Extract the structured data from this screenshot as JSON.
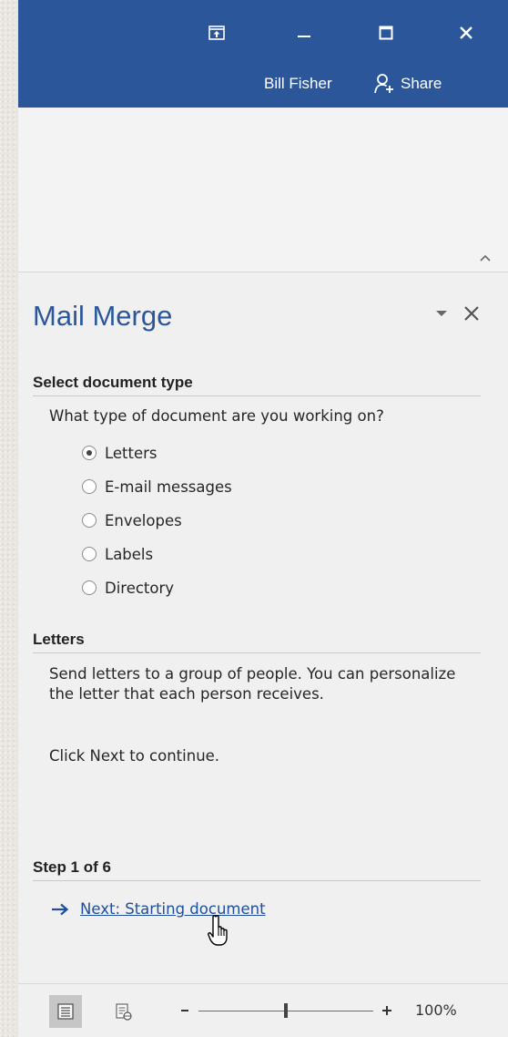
{
  "titlebar": {
    "user_name": "Bill Fisher",
    "share_label": "Share",
    "accent": "#2b579a"
  },
  "pane": {
    "title": "Mail Merge",
    "select_heading": "Select document type",
    "question": "What type of document are you working on?",
    "options": [
      {
        "label": "Letters",
        "checked": true
      },
      {
        "label": "E-mail messages",
        "checked": false
      },
      {
        "label": "Envelopes",
        "checked": false
      },
      {
        "label": "Labels",
        "checked": false
      },
      {
        "label": "Directory",
        "checked": false
      }
    ],
    "description_heading": "Letters",
    "description": "Send letters to a group of people. You can personalize the letter that each person receives.",
    "instruction": "Click Next to continue.",
    "step_heading": "Step 1 of 6",
    "next_link": "Next: Starting document"
  },
  "statusbar": {
    "zoom_level": "100%",
    "zoom_percent": 100
  },
  "icons": {
    "ribbon_display": "ribbon-display-options-icon",
    "minimize": "minimize-icon",
    "maximize": "maximize-icon",
    "close": "close-icon",
    "share": "person-add-icon",
    "collapse": "chevron-up-icon",
    "pane_menu": "triangle-down-icon",
    "pane_close": "close-icon",
    "arrow": "arrow-right-icon",
    "cursor": "hand-pointer-icon",
    "print_layout": "print-layout-icon",
    "web_layout": "web-layout-icon"
  }
}
